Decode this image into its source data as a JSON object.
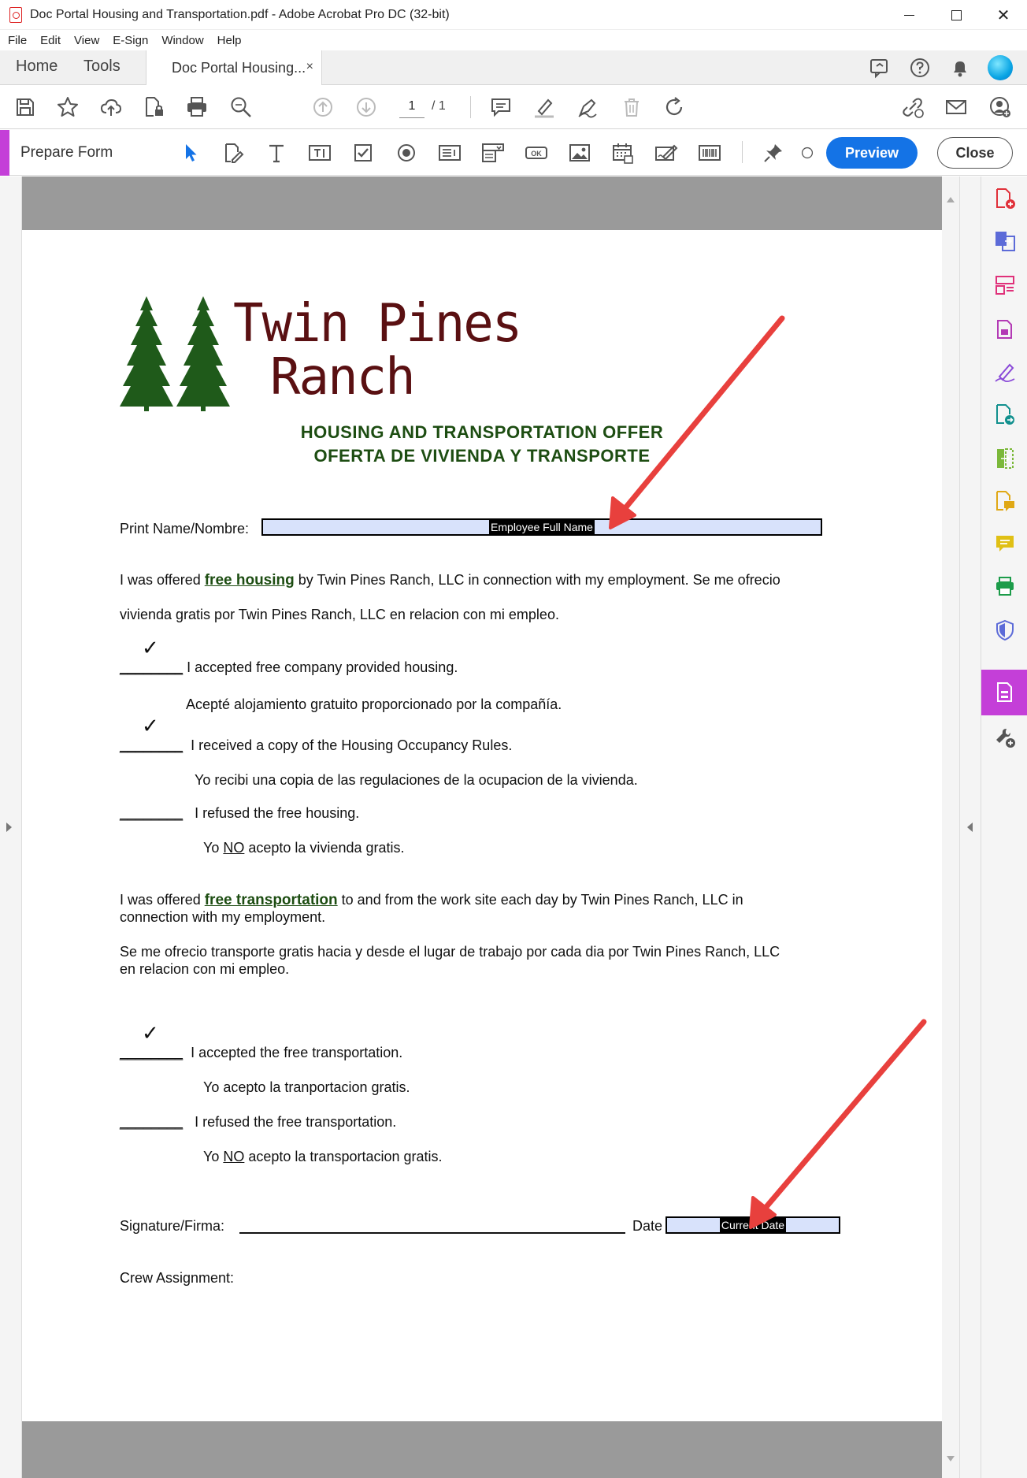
{
  "window": {
    "title": "Doc Portal Housing and Transportation.pdf - Adobe Acrobat Pro DC (32-bit)",
    "controls": {
      "minimize": "minimize",
      "maximize": "maximize",
      "close": "✕"
    }
  },
  "menu": [
    "File",
    "Edit",
    "View",
    "E-Sign",
    "Window",
    "Help"
  ],
  "tabs": {
    "home": "Home",
    "tools": "Tools",
    "document": "Doc Portal Housing...",
    "close": "×"
  },
  "toolbar": {
    "page_current": "1",
    "page_total": "/  1"
  },
  "form_bar": {
    "label": "Prepare Form",
    "preview": "Preview",
    "close": "Close"
  },
  "document": {
    "logo_line1": "Twin Pines",
    "logo_line2": "Ranch",
    "title_en": "HOUSING AND TRANSPORTATION OFFER",
    "title_es": "OFERTA DE VIVIENDA Y TRANSPORTE",
    "print_name_label": "Print Name/Nombre:",
    "name_field": "Employee Full Name",
    "housing_intro_a": "I was offered ",
    "housing_intro_link": "free housing",
    "housing_intro_b": " by Twin Pines Ranch, LLC in connection with my employment. Se me ofrecio",
    "housing_intro_2": "vivienda gratis por Twin Pines Ranch, LLC en relacion con mi empleo.",
    "check": "✓",
    "blank": "________",
    "accepted_housing": "I accepted free company provided housing.",
    "accepted_housing_es": "Acepté alojamiento gratuito proporcionado por la compañía.",
    "rules_received": "I received a copy of the Housing Occupancy Rules.",
    "rules_received_es": "Yo recibi una copia de las regulaciones de la ocupacion de la vivienda.",
    "refused_housing": "I refused the free housing.",
    "refused_housing_es_a": "Yo ",
    "no_word": "NO",
    "refused_housing_es_b": " acepto la vivienda gratis.",
    "transport_intro_a": "I was offered ",
    "transport_intro_link": "free transportation",
    "transport_intro_b": " to and from the work site each day by Twin Pines Ranch, LLC in",
    "transport_intro_2": "connection with my employment.",
    "transport_es_1": "Se me ofrecio transporte gratis hacia y desde el lugar de trabajo por cada dia por Twin Pines Ranch, LLC",
    "transport_es_2": "en relacion con mi empleo.",
    "accepted_transport": "I accepted the free transportation.",
    "accepted_transport_es": "Yo acepto la tranportacion gratis.",
    "refused_transport": "I refused the free transportation.",
    "refused_transport_es_b": " acepto la transportacion gratis.",
    "signature_label": "Signature/Firma:",
    "date_label": "Date",
    "date_field": "Current Date",
    "crew_label": "Crew Assignment:"
  },
  "colors": {
    "accent_form": "#c43fd8",
    "preview_blue": "#1473e6",
    "annotation_arrow": "#e8403d",
    "title_green": "#1d4d12",
    "logo_maroon": "#5a1012",
    "field_fill": "#d8e2fb"
  }
}
